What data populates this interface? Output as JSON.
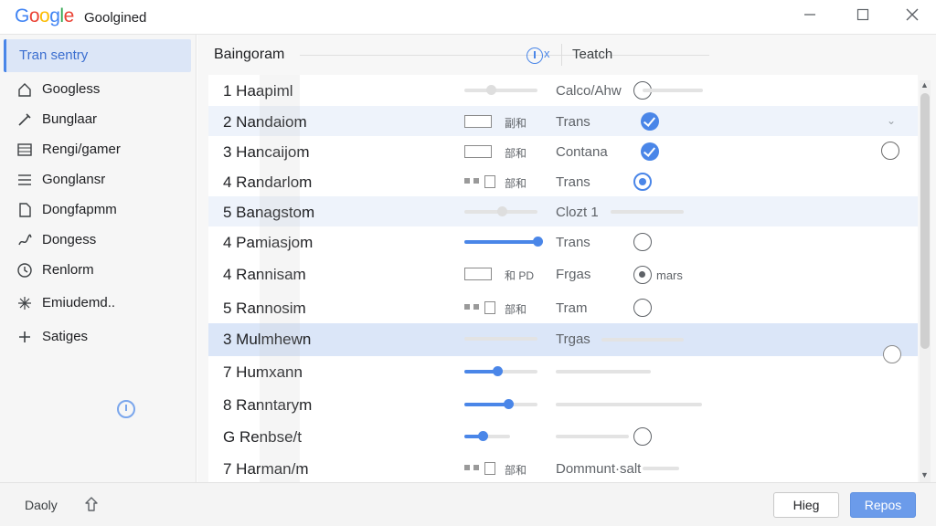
{
  "window": {
    "logo_text": "Google",
    "title": "Goolgined",
    "logo_colors": [
      "#4285F4",
      "#EA4335",
      "#FBBC05",
      "#4285F4",
      "#34A853",
      "#EA4335"
    ]
  },
  "sidebar": {
    "active": "Tran sentry",
    "items": [
      {
        "label": "Googless",
        "icon": "home-icon"
      },
      {
        "label": "Bunglaar",
        "icon": "edit-icon"
      },
      {
        "label": "Rengi/gamer",
        "icon": "grid-icon"
      },
      {
        "label": "Gonglansr",
        "icon": "list-icon"
      },
      {
        "label": "Dongfapmm",
        "icon": "document-icon"
      },
      {
        "label": "Dongess",
        "icon": "gesture-icon"
      },
      {
        "label": "Renlorm",
        "icon": "clock-icon"
      },
      {
        "label": "Emiudemd..",
        "icon": "sparkle-icon"
      },
      {
        "label": "Satiges",
        "icon": "plus-icon"
      }
    ]
  },
  "header": {
    "title": "Baingoram",
    "close_symbol": "x",
    "tab": "Teatch"
  },
  "rows": [
    {
      "name": "1 Haapiml",
      "status": "Calco/Ahw",
      "mid": "slider-grey",
      "control": "radio",
      "fill": 0.3
    },
    {
      "name": "2 Nandaiom",
      "status": "Trans",
      "mid": "box-text",
      "box_text": "副和",
      "control": "check"
    },
    {
      "name": "3 Hancaijom",
      "status": "Contana",
      "mid": "box-text",
      "box_text": "部和",
      "control": "check"
    },
    {
      "name": "4 Randarlom",
      "status": "Trans",
      "mid": "dash-text",
      "box_text": "部和",
      "control": "radio-checked"
    },
    {
      "name": "5 Banagstom",
      "status": "Clozt 1",
      "mid": "slider-grey",
      "control": "none",
      "fill": 0.45
    },
    {
      "name": "4 Pamiasjom",
      "status": "Trans",
      "mid": "slider-blue",
      "control": "radio",
      "fill": 1.0
    },
    {
      "name": "4 Rannisam",
      "status": "Frgas",
      "mid": "box-text",
      "box_text": "和 PD",
      "control": "radio-dot",
      "control_text": "mars"
    },
    {
      "name": "5 Rannosim",
      "status": "Tram",
      "mid": "dash-text",
      "box_text": "部和",
      "control": "radio"
    },
    {
      "name": "3 Mulmhewn",
      "status": "Trgas",
      "mid": "slider-grey",
      "control": "none",
      "fill": 0.0
    },
    {
      "name": "7 Humxann",
      "status": "",
      "mid": "slider-blue",
      "control": "none",
      "fill": 0.45
    },
    {
      "name": "8 Ranntarym",
      "status": "",
      "mid": "slider-blue",
      "control": "none",
      "fill": 0.6
    },
    {
      "name": "G Renbse/t",
      "status": "",
      "mid": "slider-blue-small",
      "control": "radio",
      "fill": 0.4
    },
    {
      "name": "7 Harman/m",
      "status": "Dommunt·salt",
      "mid": "dash-text",
      "box_text": "部和",
      "control": "none"
    }
  ],
  "footer": {
    "left_label": "Daoly",
    "secondary_button": "Hieg",
    "primary_button": "Repos"
  },
  "colors": {
    "accent": "#4A86E8",
    "selected_row": "#DBE6F8",
    "light_row": "#EEF3FB"
  }
}
